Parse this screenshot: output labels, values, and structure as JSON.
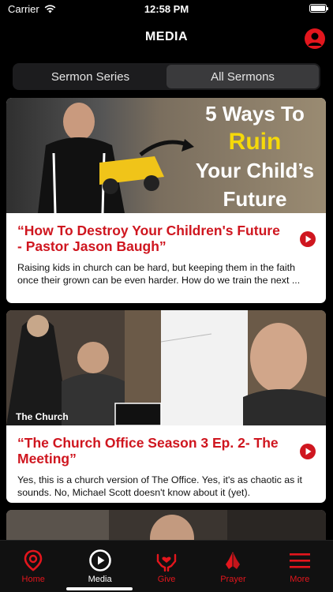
{
  "status_bar": {
    "carrier": "Carrier",
    "time": "12:58 PM"
  },
  "header": {
    "title": "MEDIA",
    "profile_icon": "person-circle-icon"
  },
  "segments": [
    {
      "label": "Sermon Series",
      "active": false
    },
    {
      "label": "All Sermons",
      "active": true
    }
  ],
  "cards": [
    {
      "title": "“How To Destroy Your Children's Future - Pastor Jason Baugh”",
      "description": "Raising kids in church can be hard, but keeping them in the faith once their grown can be even harder. How do we train the next ...",
      "thumbnail": {
        "line1": "5 Ways To",
        "line2": "Ruin",
        "line3": "Your Child’s",
        "line4": "Future"
      }
    },
    {
      "title": "“The Church Office Season 3 Ep. 2- The Meeting”",
      "description": "Yes, this is a church version of The Office. Yes, it's as chaotic as it sounds. No, Michael Scott doesn't know about it (yet).",
      "thumbnail": {
        "caption": "The Church"
      }
    }
  ],
  "tabs": [
    {
      "label": "Home",
      "icon": "home-pin-icon",
      "active": false
    },
    {
      "label": "Media",
      "icon": "play-circle-icon",
      "active": true
    },
    {
      "label": "Give",
      "icon": "give-hands-heart-icon",
      "active": false
    },
    {
      "label": "Prayer",
      "icon": "praying-hands-icon",
      "active": false
    },
    {
      "label": "More",
      "icon": "menu-icon",
      "active": false
    }
  ],
  "colors": {
    "accent": "#e3161d",
    "title_red": "#cf161f",
    "background": "#000000"
  }
}
